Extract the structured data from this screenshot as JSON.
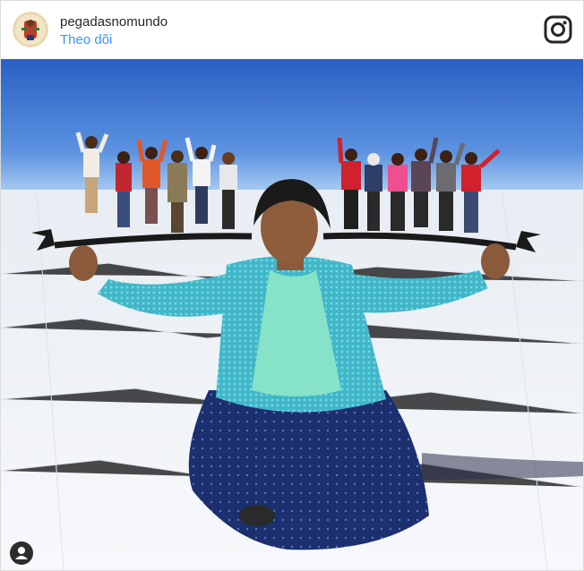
{
  "post": {
    "username": "pegadasnomundo",
    "follow_label": "Theo dõi"
  },
  "icons": {
    "avatar": "profile-avatar",
    "brand": "instagram-icon",
    "tag": "user-tag-icon"
  },
  "colors": {
    "link": "#3897f0",
    "text": "#262626",
    "sky_top": "#2b63c6",
    "sky_bottom": "#9cc3ee",
    "salt_flat": "#f2f4f8"
  }
}
